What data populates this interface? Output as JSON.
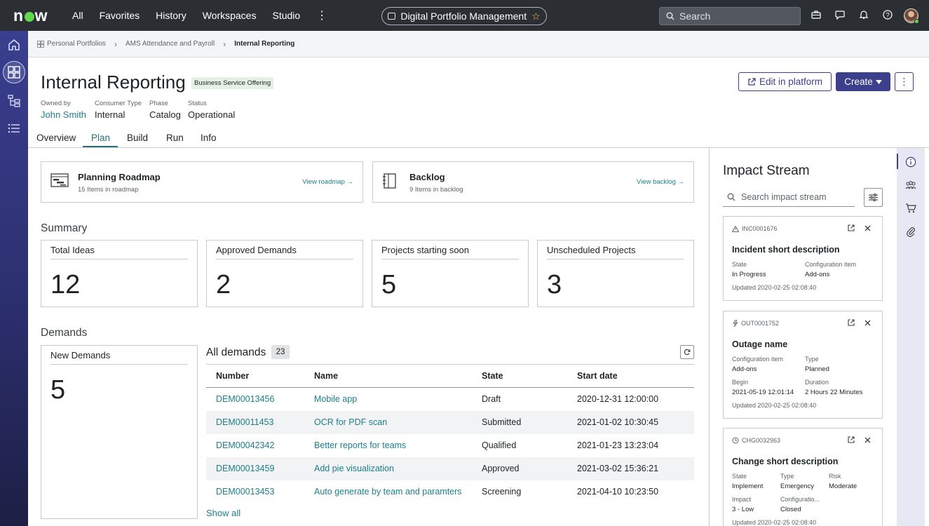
{
  "topnav": {
    "logo": "now",
    "links": [
      "All",
      "Favorites",
      "History",
      "Workspaces",
      "Studio"
    ],
    "workspace_pill": "Digital Portfolio Management",
    "search_placeholder": "Search"
  },
  "breadcrumb": {
    "items": [
      "Personal Portfolios",
      "AMS Attendance and Payroll",
      "Internal Reporting"
    ]
  },
  "header": {
    "title": "Internal Reporting",
    "badge": "Business Service Offering",
    "meta": [
      {
        "label": "Owned by",
        "value": "John Smith"
      },
      {
        "label": "Consumer Type",
        "value": "Internal"
      },
      {
        "label": "Phase",
        "value": "Catalog"
      },
      {
        "label": "Status",
        "value": "Operational"
      }
    ],
    "edit_label": "Edit in platform",
    "create_label": "Create"
  },
  "tabs": [
    "Overview",
    "Plan",
    "Build",
    "Run",
    "Info"
  ],
  "active_tab": "Plan",
  "nav_cards": [
    {
      "title": "Planning Roadmap",
      "subtitle": "15 Items in roadmap",
      "link": "View roadmap"
    },
    {
      "title": "Backlog",
      "subtitle": "9 Items in backlog",
      "link": "View backlog"
    }
  ],
  "summary": {
    "title": "Summary",
    "stats": [
      {
        "label": "Total Ideas",
        "value": "12"
      },
      {
        "label": "Approved Demands",
        "value": "2"
      },
      {
        "label": "Projects starting soon",
        "value": "5"
      },
      {
        "label": "Unscheduled Projects",
        "value": "3"
      }
    ]
  },
  "demands": {
    "title": "Demands",
    "new_label": "New Demands",
    "new_value": "5",
    "all_title": "All demands",
    "all_count": "23",
    "columns": [
      "Number",
      "Name",
      "State",
      "Start date"
    ],
    "rows": [
      {
        "number": "DEM00013456",
        "name": "Mobile app",
        "state": "Draft",
        "start": "2020-12-31 12:00:00"
      },
      {
        "number": "DEM00011453",
        "name": "OCR for PDF scan",
        "state": "Submitted",
        "start": "2021-01-02 10:30:45"
      },
      {
        "number": "DEM00042342",
        "name": "Better reports for teams",
        "state": "Qualified",
        "start": "2021-01-23 13:23:04"
      },
      {
        "number": "DEM00013459",
        "name": "Add pie visualization",
        "state": "Approved",
        "start": "2021-03-02 15:36:21"
      },
      {
        "number": "DEM00013453",
        "name": "Auto generate by team and paramters",
        "state": "Screening",
        "start": "2021-04-10 10:23:50"
      }
    ],
    "show_all": "Show all"
  },
  "impact_stream": {
    "title": "Impact Stream",
    "search_placeholder": "Search impact stream",
    "cards": [
      {
        "id": "INC0001676",
        "heading": "Incident short description",
        "f1_label": "State",
        "f1_value": "In Progress",
        "f2_label": "Configuration item",
        "f2_value": "Add-ons",
        "updated": "Updated 2020-02-25 02:08:40"
      },
      {
        "id": "OUT0001752",
        "heading": "Outage name",
        "f1_label": "Configuration item",
        "f1_value": "Add-ons",
        "f2_label": "Type",
        "f2_value": "Planned",
        "f3_label": "Begin",
        "f3_value": "2021-05-19 12:01:14",
        "f4_label": "Duration",
        "f4_value": "2 Hours 22 Minutes",
        "updated": "Updated 2020-02-25 02:08:40"
      },
      {
        "id": "CHG0032963",
        "heading": "Change short description",
        "f1_label": "State",
        "f1_value": "Implement",
        "f2_label": "Type",
        "f2_value": "Emergency",
        "f3_label": "Risk",
        "f3_value": "Moderate",
        "f4_label": "Impact",
        "f4_value": "3 - Low",
        "f5_label": "Configuratio...",
        "f5_value": "Closed",
        "updated": "Updated 2020-02-25 02:08:40"
      }
    ]
  },
  "colors": {
    "topnav_bg": "#2b2f33",
    "primary": "#3b3f8c",
    "link": "#1c7f8a",
    "badge_bg": "#e6f1e5"
  }
}
